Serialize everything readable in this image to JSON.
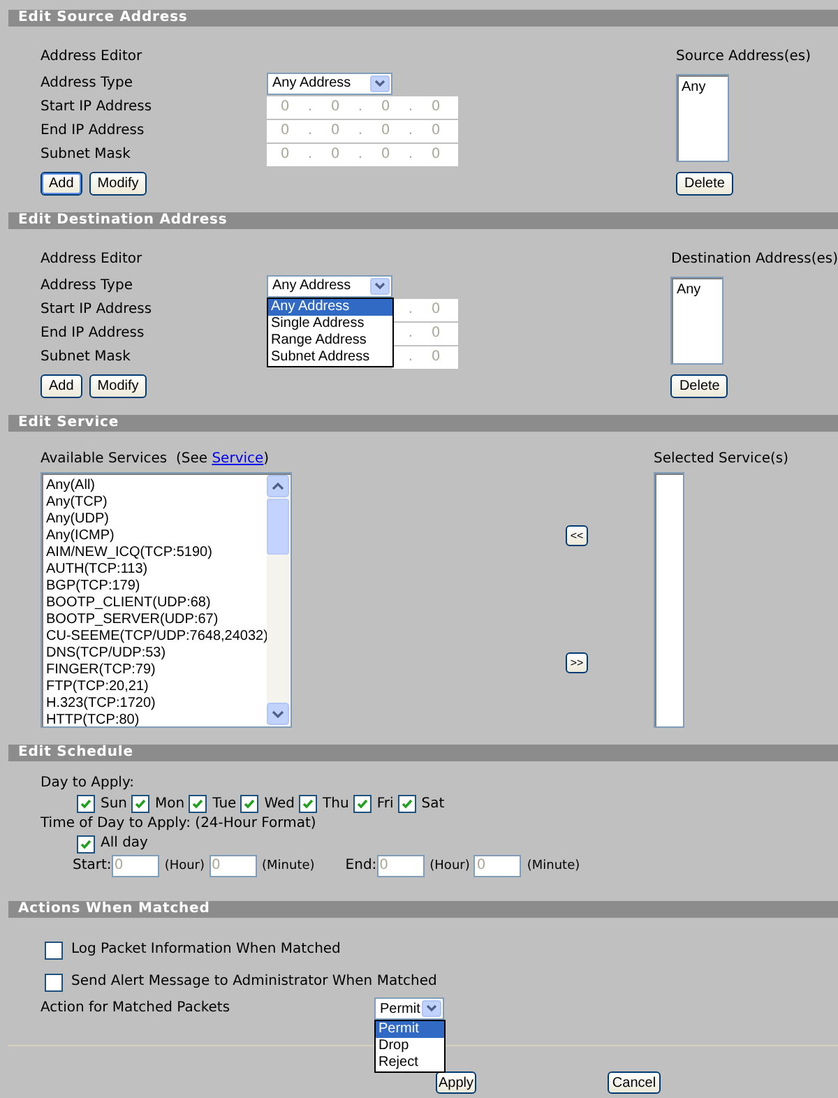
{
  "source_address": {
    "title": "Edit Source Address",
    "editor_label": "Address Editor",
    "type_label": "Address Type",
    "type_value": "Any Address",
    "fields": [
      {
        "label": "Start IP Address",
        "parts": [
          "0",
          ".",
          "0",
          ".",
          "0",
          ".",
          "0"
        ]
      },
      {
        "label": "End IP Address",
        "parts": [
          "0",
          ".",
          "0",
          ".",
          "0",
          ".",
          "0"
        ]
      },
      {
        "label": "Subnet Mask",
        "parts": [
          "0",
          ".",
          "0",
          ".",
          "0",
          ".",
          "0"
        ]
      }
    ],
    "buttons": [
      {
        "label": "Add",
        "default": true
      },
      {
        "label": "Modify",
        "default": false
      }
    ],
    "list_label": "Source Address(es)",
    "list_items": [
      "Any"
    ],
    "delete_button": "Delete"
  },
  "destination_address": {
    "title": "Edit Destination Address",
    "editor_label": "Address Editor",
    "type_label": "Address Type",
    "type_value": "Any Address",
    "type_options": [
      {
        "label": "Any Address",
        "selected": true
      },
      {
        "label": "Single Address",
        "selected": false
      },
      {
        "label": "Range Address",
        "selected": false
      },
      {
        "label": "Subnet Address",
        "selected": false
      }
    ],
    "fields": [
      {
        "label": "Start IP Address",
        "parts": [
          ".",
          "0"
        ]
      },
      {
        "label": "End IP Address",
        "parts": [
          ".",
          "0"
        ]
      },
      {
        "label": "Subnet Mask",
        "parts": [
          ".",
          "0"
        ]
      }
    ],
    "buttons": [
      {
        "label": "Add",
        "default": false
      },
      {
        "label": "Modify",
        "default": false
      }
    ],
    "list_label": "Destination Address(es)",
    "list_items": [
      "Any"
    ],
    "delete_button": "Delete"
  },
  "service": {
    "title": "Edit Service",
    "available_label": "Available Services  (See ",
    "link": "Service",
    "available_label_end": ")",
    "available_services": [
      "Any(All)",
      "Any(TCP)",
      "Any(UDP)",
      "Any(ICMP)",
      "AIM/NEW_ICQ(TCP:5190)",
      "AUTH(TCP:113)",
      "BGP(TCP:179)",
      "BOOTP_CLIENT(UDP:68)",
      "BOOTP_SERVER(UDP:67)",
      "CU-SEEME(TCP/UDP:7648,24032)",
      "DNS(TCP/UDP:53)",
      "FINGER(TCP:79)",
      "FTP(TCP:20,21)",
      "H.323(TCP:1720)",
      "HTTP(TCP:80)"
    ],
    "move_buttons": [
      "<<",
      ">>"
    ],
    "selected_label": "Selected Service(s)"
  },
  "schedule": {
    "title": "Edit Schedule",
    "day_label": "Day to Apply:",
    "days": [
      {
        "label": "Sun",
        "checked": true
      },
      {
        "label": "Mon",
        "checked": true
      },
      {
        "label": "Tue",
        "checked": true
      },
      {
        "label": "Wed",
        "checked": true
      },
      {
        "label": "Thu",
        "checked": true
      },
      {
        "label": "Fri",
        "checked": true
      },
      {
        "label": "Sat",
        "checked": true
      }
    ],
    "time_label": "Time of Day to Apply: (24-Hour Format)",
    "all_day": {
      "label": "All day",
      "checked": true
    },
    "times": [
      {
        "label": "Start:",
        "hour": "0",
        "hour_unit": "(Hour)",
        "minute": "0",
        "minute_unit": "(Minute)"
      },
      {
        "label": "End:",
        "hour": "0",
        "hour_unit": "(Hour)",
        "minute": "0",
        "minute_unit": "(Minute)"
      }
    ]
  },
  "actions": {
    "title": "Actions When Matched",
    "options": [
      {
        "label": "Log Packet Information When Matched",
        "checked": false
      },
      {
        "label": "Send Alert Message to Administrator When Matched",
        "checked": false
      }
    ],
    "action_label": "Action for Matched Packets",
    "action_value": "Permit",
    "action_options": [
      {
        "label": "Permit",
        "selected": true
      },
      {
        "label": "Drop",
        "selected": false
      },
      {
        "label": "Reject",
        "selected": false
      }
    ]
  },
  "footer_buttons": [
    "Apply",
    "Cancel"
  ]
}
